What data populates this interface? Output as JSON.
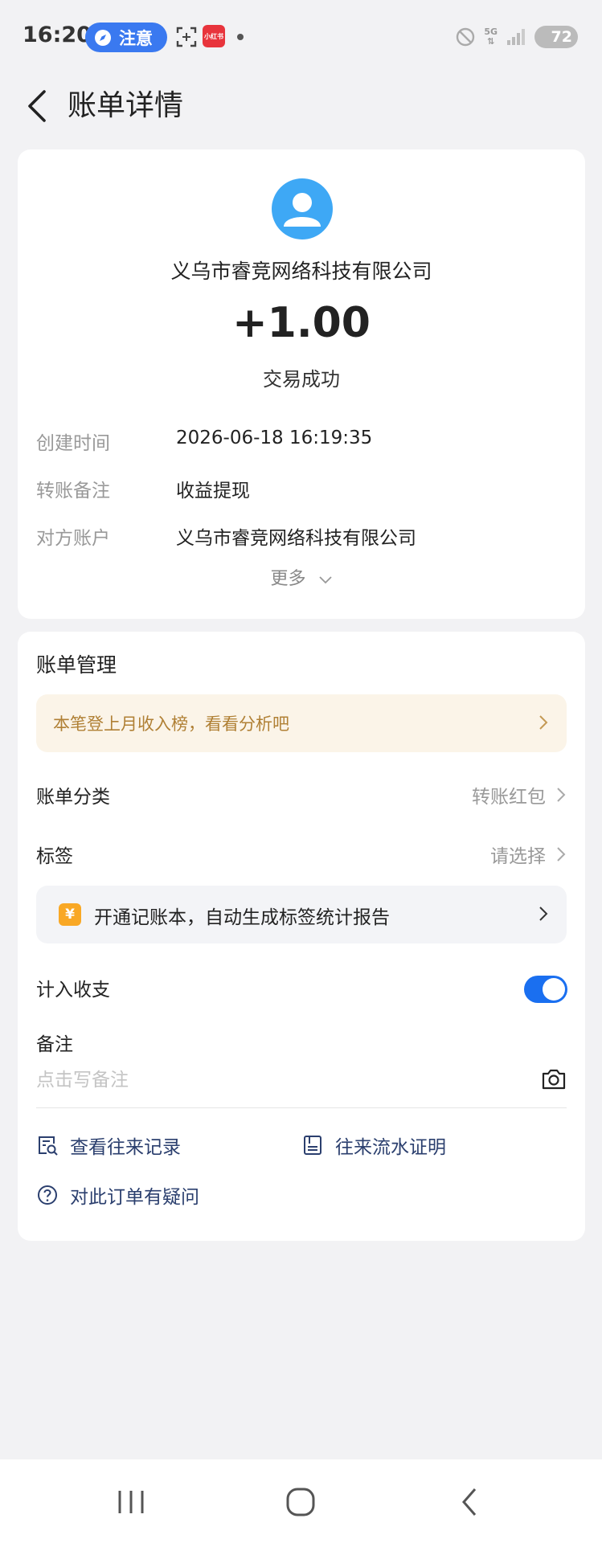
{
  "status_bar": {
    "time": "16:20",
    "notice_label": "注意",
    "xhs_badge": "小红书",
    "network": "5G",
    "battery": "72"
  },
  "header": {
    "title": "账单详情"
  },
  "summary": {
    "merchant_name": "义乌市睿竞网络科技有限公司",
    "amount": "+1.00",
    "status": "交易成功",
    "rows": [
      {
        "label": "创建时间",
        "value": "2026-06-18 16:19:35"
      },
      {
        "label": "转账备注",
        "value": "收益提现"
      },
      {
        "label": "对方账户",
        "value": "义乌市睿竞网络科技有限公司"
      }
    ],
    "more_label": "更多"
  },
  "management": {
    "title": "账单管理",
    "promo_text": "本笔登上月收入榜，看看分析吧",
    "category_label": "账单分类",
    "category_value": "转账红包",
    "tag_label": "标签",
    "tag_value": "请选择",
    "bookkeeping_text": "开通记账本，自动生成标签统计报告",
    "bookkeeping_coin": "¥",
    "include_label": "计入收支",
    "include_enabled": true,
    "remark_label": "备注",
    "remark_placeholder": "点击写备注",
    "links": {
      "history": "查看往来记录",
      "proof": "往来流水证明",
      "question": "对此订单有疑问"
    }
  },
  "colors": {
    "accent": "#1a6ff0",
    "avatar": "#3ea8f5",
    "promo_text": "#b08035",
    "link_text": "#2b3f6e"
  }
}
